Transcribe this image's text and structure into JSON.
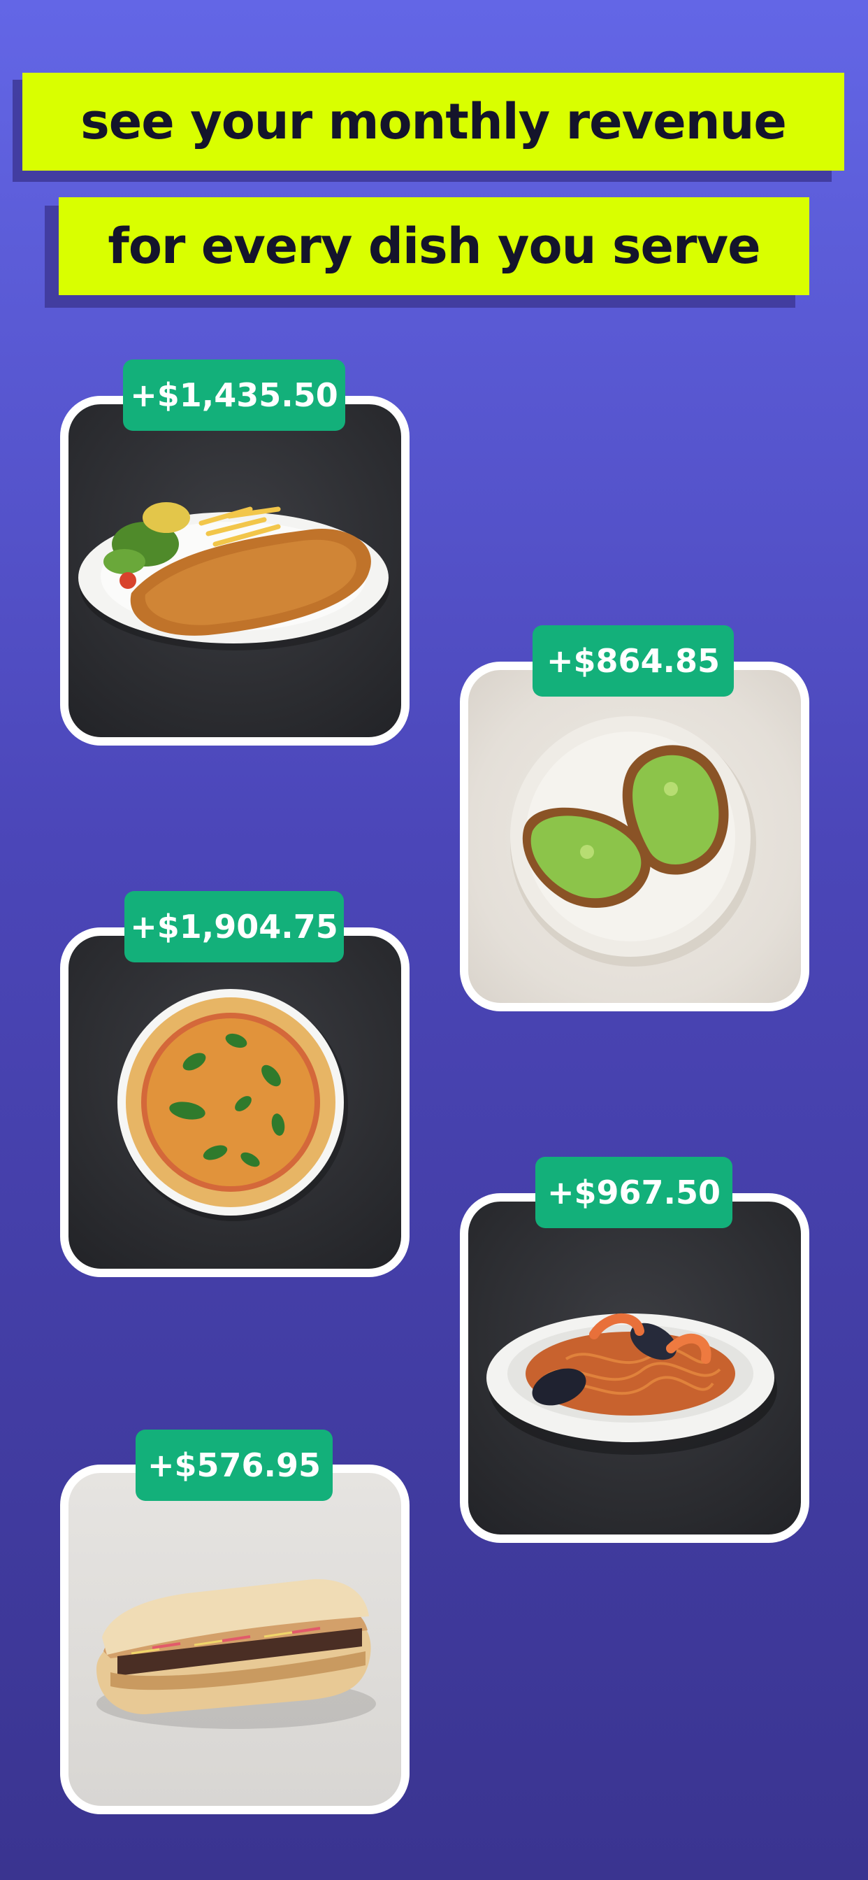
{
  "headline": {
    "line1": "see your monthly revenue",
    "line2": "for every dish you serve"
  },
  "colors": {
    "background_top": "#6366e6",
    "background_bottom": "#3a3490",
    "highlight": "#d9ff00",
    "badge": "#13b07a",
    "card_border": "#ffffff"
  },
  "dishes": [
    {
      "name": "schnitzel",
      "revenue": "+$1,435.50"
    },
    {
      "name": "avocado-toast",
      "revenue": "+$864.85"
    },
    {
      "name": "pizza",
      "revenue": "+$1,904.75"
    },
    {
      "name": "seafood-pasta",
      "revenue": "+$967.50"
    },
    {
      "name": "sandwich",
      "revenue": "+$576.95"
    }
  ]
}
